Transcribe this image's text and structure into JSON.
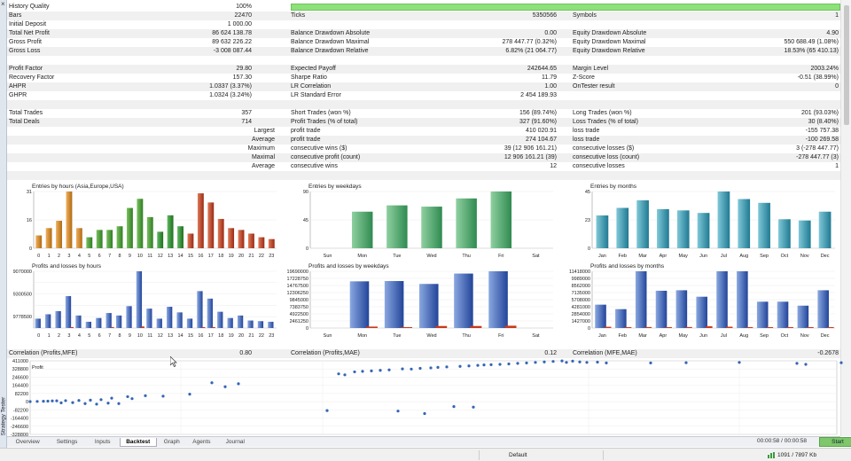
{
  "side_label": "Strategy Tester",
  "colors": {
    "quality_bar": "#8ee07a",
    "row_alt": "#f0f0f0",
    "scatter": "#3465b5",
    "start_button": "#7ec76a"
  },
  "report": {
    "rows": [
      {
        "g": false,
        "c1": "History Quality",
        "v1": "100%",
        "bar": true
      },
      {
        "g": true,
        "c1": "Bars",
        "v1": "22470",
        "c2": "Ticks",
        "v2": "5350566",
        "c3": "Symbols",
        "v3": "1"
      },
      {
        "g": false,
        "c1": "Initial Deposit",
        "v1": "1 000.00"
      },
      {
        "g": true,
        "c1": "Total Net Profit",
        "v1": "86 624 138.78",
        "c2": "Balance Drawdown Absolute",
        "v2": "0.00",
        "c3": "Equity Drawdown Absolute",
        "v3": "4.90"
      },
      {
        "g": false,
        "c1": "Gross Profit",
        "v1": "89 632 226.22",
        "c2": "Balance Drawdown Maximal",
        "v2": "278 447.77 (0.32%)",
        "c3": "Equity Drawdown Maximal",
        "v3": "550 688.49 (1.08%)"
      },
      {
        "g": true,
        "c1": "Gross Loss",
        "v1": "-3 008 087.44",
        "c2": "Balance Drawdown Relative",
        "v2": "6.82% (21 064.77)",
        "c3": "Equity Drawdown Relative",
        "v3": "18.53% (65 410.13)"
      },
      {
        "g": false
      },
      {
        "g": true,
        "c1": "Profit Factor",
        "v1": "29.80",
        "c2": "Expected Payoff",
        "v2": "242644.65",
        "c3": "Margin Level",
        "v3": "2003.24%"
      },
      {
        "g": false,
        "c1": "Recovery Factor",
        "v1": "157.30",
        "c2": "Sharpe Ratio",
        "v2": "11.79",
        "c3": "Z-Score",
        "v3": "-0.51 (38.99%)"
      },
      {
        "g": true,
        "c1": "AHPR",
        "v1": "1.0337 (3.37%)",
        "c2": "LR Correlation",
        "v2": "1.00",
        "c3": "OnTester result",
        "v3": "0"
      },
      {
        "g": false,
        "c1": "GHPR",
        "v1": "1.0324 (3.24%)",
        "c2": "LR Standard Error",
        "v2": "2 454 189.93"
      },
      {
        "g": true
      },
      {
        "g": false,
        "c1": "Total Trades",
        "v1": "357",
        "c2": "Short Trades (won %)",
        "v2": "156 (89.74%)",
        "c3": "Long Trades (won %)",
        "v3": "201 (93.03%)"
      },
      {
        "g": true,
        "c1": "Total Deals",
        "v1": "714",
        "c2": "Profit Trades (% of total)",
        "v2": "327 (91.60%)",
        "c3": "Loss Trades (% of total)",
        "v3": "30 (8.40%)"
      },
      {
        "g": false,
        "r1": "Largest",
        "c2": "profit trade",
        "v2": "410 020.91",
        "c3": "loss trade",
        "v3": "-155 757.38"
      },
      {
        "g": true,
        "r1": "Average",
        "c2": "profit trade",
        "v2": "274 104.67",
        "c3": "loss trade",
        "v3": "-100 269.58"
      },
      {
        "g": false,
        "r1": "Maximum",
        "c2": "consecutive wins ($)",
        "v2": "39 (12 906 161.21)",
        "c3": "consecutive losses ($)",
        "v3": "3 (-278 447.77)"
      },
      {
        "g": true,
        "r1": "Maximal",
        "c2": "consecutive profit (count)",
        "v2": "12 906 161.21 (39)",
        "c3": "consecutive loss (count)",
        "v3": "-278 447.77 (3)"
      },
      {
        "g": false,
        "r1": "Average",
        "c2": "consecutive wins",
        "v2": "12",
        "c3": "consecutive losses",
        "v3": "1"
      },
      {
        "g": true
      }
    ]
  },
  "correlation": {
    "c1": "Correlation (Profits,MFE)",
    "v1": "0.80",
    "c2": "Correlation (Profits,MAE)",
    "v2": "0.12",
    "c3": "Correlation (MFE,MAE)",
    "v3": "-0.2678"
  },
  "chart_data": [
    {
      "type": "bar",
      "title": "Entries by hours (Asia,Europe,USA)",
      "ylim": [
        0,
        31
      ],
      "yticks": [
        "31",
        "16",
        "0"
      ],
      "categories": [
        "0",
        "1",
        "2",
        "3",
        "4",
        "5",
        "6",
        "7",
        "8",
        "9",
        "10",
        "11",
        "12",
        "13",
        "14",
        "15",
        "16",
        "17",
        "18",
        "19",
        "20",
        "21",
        "22",
        "23"
      ],
      "values": [
        7,
        11,
        15,
        31,
        11,
        6,
        10,
        10,
        12,
        22,
        27,
        17,
        9,
        18,
        12,
        8,
        30,
        25,
        16,
        11,
        10,
        8,
        6,
        5
      ]
    },
    {
      "type": "bar",
      "title": "Entries by weekdays",
      "ylim": [
        0,
        90
      ],
      "yticks": [
        "90",
        "45",
        "0"
      ],
      "categories": [
        "Sun",
        "Mon",
        "Tue",
        "Wed",
        "Thu",
        "Fri",
        "Sat"
      ],
      "values": [
        0,
        58,
        68,
        66,
        79,
        90,
        0
      ]
    },
    {
      "type": "bar",
      "title": "Entries by months",
      "ylim": [
        0,
        45
      ],
      "yticks": [
        "45",
        "23",
        "0"
      ],
      "categories": [
        "Jan",
        "Feb",
        "Mar",
        "Apr",
        "May",
        "Jun",
        "Jul",
        "Aug",
        "Sep",
        "Oct",
        "Nov",
        "Dec"
      ],
      "values": [
        26,
        32,
        38,
        31,
        30,
        28,
        45,
        39,
        36,
        23,
        22,
        29
      ]
    },
    {
      "type": "bar",
      "title": "Profits and losses by hours",
      "ylim": [
        0,
        9070000
      ],
      "yticks": [
        "9070000",
        "",
        "9300500",
        "",
        "9778500",
        ""
      ],
      "categories": [
        "0",
        "1",
        "2",
        "3",
        "4",
        "5",
        "6",
        "7",
        "8",
        "9",
        "10",
        "11",
        "12",
        "13",
        "14",
        "15",
        "16",
        "17",
        "18",
        "19",
        "20",
        "21",
        "22",
        "23"
      ],
      "series": [
        {
          "name": "Profit",
          "values": [
            1500000,
            2200000,
            2700000,
            5100000,
            2000000,
            1000000,
            1600000,
            2400000,
            2000000,
            3500000,
            9070000,
            3100000,
            1500000,
            3400000,
            2500000,
            1500000,
            5900000,
            4700000,
            2600000,
            1600000,
            2000000,
            1200000,
            1100000,
            1000000
          ]
        },
        {
          "name": "Loss",
          "values": [
            0,
            0,
            0,
            60000,
            0,
            0,
            0,
            40000,
            0,
            0,
            250000,
            0,
            0,
            0,
            0,
            0,
            50000,
            60000,
            0,
            0,
            0,
            0,
            0,
            0
          ]
        }
      ]
    },
    {
      "type": "bar",
      "title": "Profits and losses by weekdays",
      "ylim": [
        0,
        19690000
      ],
      "yticks": [
        "19690000",
        "17228750",
        "14767500",
        "12306250",
        "9845000",
        "7383750",
        "4922500",
        "2461250",
        "0"
      ],
      "categories": [
        "Sun",
        "Mon",
        "Tue",
        "Wed",
        "Thu",
        "Fri",
        "Sat"
      ],
      "series": [
        {
          "name": "Profit",
          "values": [
            0,
            16200000,
            16300000,
            15300000,
            18900000,
            19690000,
            0
          ]
        },
        {
          "name": "Loss",
          "values": [
            0,
            500000,
            300000,
            700000,
            700000,
            800000,
            0
          ]
        }
      ]
    },
    {
      "type": "bar",
      "title": "Profits and losses by months",
      "ylim": [
        0,
        11418000
      ],
      "yticks": [
        "11418000",
        "9989000",
        "8562000",
        "7135000",
        "5708000",
        "4281000",
        "2854000",
        "1427000",
        "0"
      ],
      "categories": [
        "Jan",
        "Feb",
        "Mar",
        "Apr",
        "May",
        "Jun",
        "Jul",
        "Aug",
        "Sep",
        "Oct",
        "Nov",
        "Dec"
      ],
      "series": [
        {
          "name": "Profit",
          "values": [
            4700000,
            3800000,
            11418000,
            7500000,
            7600000,
            6300000,
            11418000,
            11418000,
            5300000,
            5300000,
            4500000,
            7600000
          ]
        },
        {
          "name": "Loss",
          "values": [
            250000,
            120000,
            200000,
            100000,
            200000,
            350000,
            260000,
            150000,
            100000,
            100000,
            80000,
            120000
          ]
        }
      ]
    },
    {
      "type": "scatter",
      "title": "Profit",
      "ylim": [
        -330000,
        411000
      ],
      "yticks": [
        "411000",
        "328800",
        "246600",
        "164400",
        "82200",
        "0",
        "-82200",
        "-164400",
        "-246600",
        "-328800"
      ],
      "points": [
        [
          0,
          0
        ],
        [
          8,
          2000
        ],
        [
          15,
          4000
        ],
        [
          20,
          5000
        ],
        [
          25,
          7000
        ],
        [
          30,
          8000
        ],
        [
          35,
          -12000
        ],
        [
          40,
          10000
        ],
        [
          48,
          -10000
        ],
        [
          55,
          12000
        ],
        [
          62,
          -20000
        ],
        [
          68,
          15000
        ],
        [
          75,
          -25000
        ],
        [
          80,
          20000
        ],
        [
          88,
          -15000
        ],
        [
          92,
          35000
        ],
        [
          100,
          -20000
        ],
        [
          110,
          50000
        ],
        [
          115,
          30000
        ],
        [
          130,
          60000
        ],
        [
          150,
          55000
        ],
        [
          180,
          75000
        ],
        [
          205,
          190000
        ],
        [
          220,
          150000
        ],
        [
          235,
          180000
        ],
        [
          335,
          -90000
        ],
        [
          348,
          280000
        ],
        [
          355,
          270000
        ],
        [
          366,
          300000
        ],
        [
          375,
          305000
        ],
        [
          385,
          310000
        ],
        [
          395,
          315000
        ],
        [
          405,
          320000
        ],
        [
          415,
          -95000
        ],
        [
          420,
          330000
        ],
        [
          430,
          328000
        ],
        [
          440,
          335000
        ],
        [
          445,
          -120000
        ],
        [
          452,
          340000
        ],
        [
          460,
          345000
        ],
        [
          470,
          350000
        ],
        [
          478,
          -50000
        ],
        [
          485,
          355000
        ],
        [
          495,
          360000
        ],
        [
          500,
          -55000
        ],
        [
          505,
          365000
        ],
        [
          512,
          370000
        ],
        [
          520,
          372000
        ],
        [
          530,
          375000
        ],
        [
          540,
          380000
        ],
        [
          550,
          385000
        ],
        [
          560,
          390000
        ],
        [
          570,
          395000
        ],
        [
          580,
          400000
        ],
        [
          590,
          405000
        ],
        [
          600,
          410000
        ],
        [
          605,
          395000
        ],
        [
          612,
          408000
        ],
        [
          620,
          400000
        ],
        [
          628,
          395000
        ],
        [
          640,
          398000
        ],
        [
          650,
          390000
        ],
        [
          700,
          390000
        ],
        [
          740,
          392000
        ],
        [
          800,
          395000
        ],
        [
          865,
          385000
        ],
        [
          875,
          375000
        ],
        [
          915,
          392000
        ]
      ]
    }
  ],
  "tabs": {
    "items": [
      {
        "label": "Overview",
        "active": false
      },
      {
        "label": "Settings",
        "active": false
      },
      {
        "label": "Inputs",
        "active": false
      },
      {
        "label": "Backtest",
        "active": true
      },
      {
        "label": "Graph",
        "active": false
      },
      {
        "label": "Agents",
        "active": false
      },
      {
        "label": "Journal",
        "active": false
      }
    ],
    "timer": "00:00:58 / 00:00:58",
    "start": "Start"
  },
  "status": {
    "profile": "Default",
    "memory": "1091 / 7897 Kb"
  }
}
